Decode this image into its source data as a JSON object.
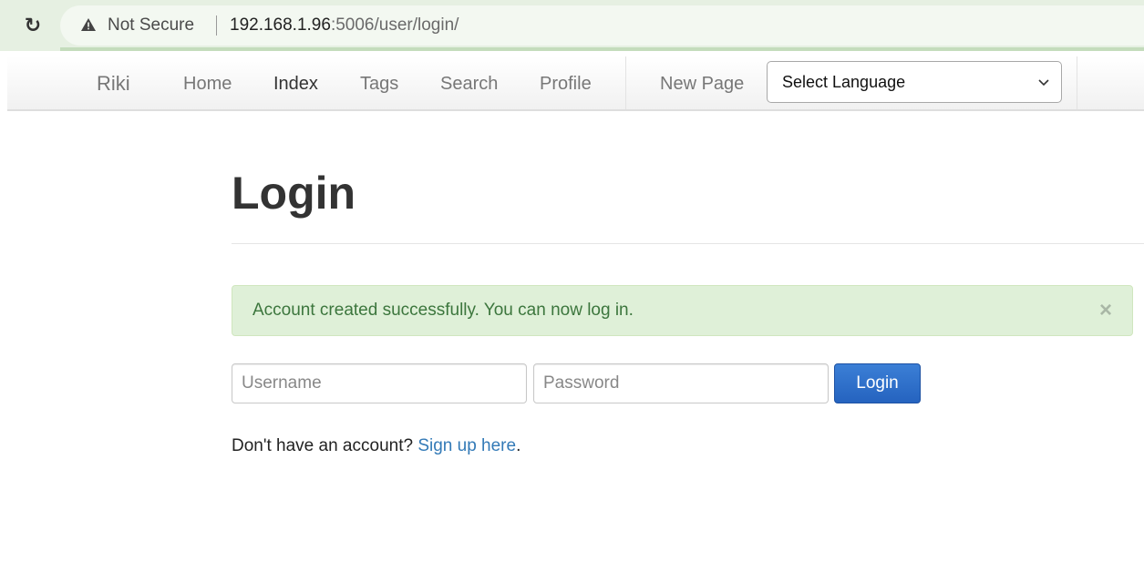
{
  "browser": {
    "security_label": "Not Secure",
    "url_host": "192.168.1.96",
    "url_rest": ":5006/user/login/"
  },
  "navbar": {
    "brand": "Riki",
    "links": [
      "Home",
      "Index",
      "Tags",
      "Search",
      "Profile"
    ],
    "new_page": "New Page",
    "language_select": "Select Language"
  },
  "main": {
    "title": "Login",
    "alert": {
      "message": "Account created successfully. You can now log in.",
      "close_glyph": "×"
    },
    "form": {
      "username_placeholder": "Username",
      "password_placeholder": "Password",
      "submit_label": "Login"
    },
    "signup": {
      "prefix": "Don't have an account? ",
      "link_text": "Sign up here",
      "suffix": "."
    }
  },
  "colors": {
    "alert_bg": "#dff0d8",
    "alert_text": "#3c763d",
    "primary_button": "#2c6fcf",
    "link": "#337ab7"
  },
  "icons": {
    "reload": "reload-icon",
    "warning": "warning-triangle-icon",
    "select_chevron": "chevron-down-icon",
    "alert_close": "close-icon"
  }
}
